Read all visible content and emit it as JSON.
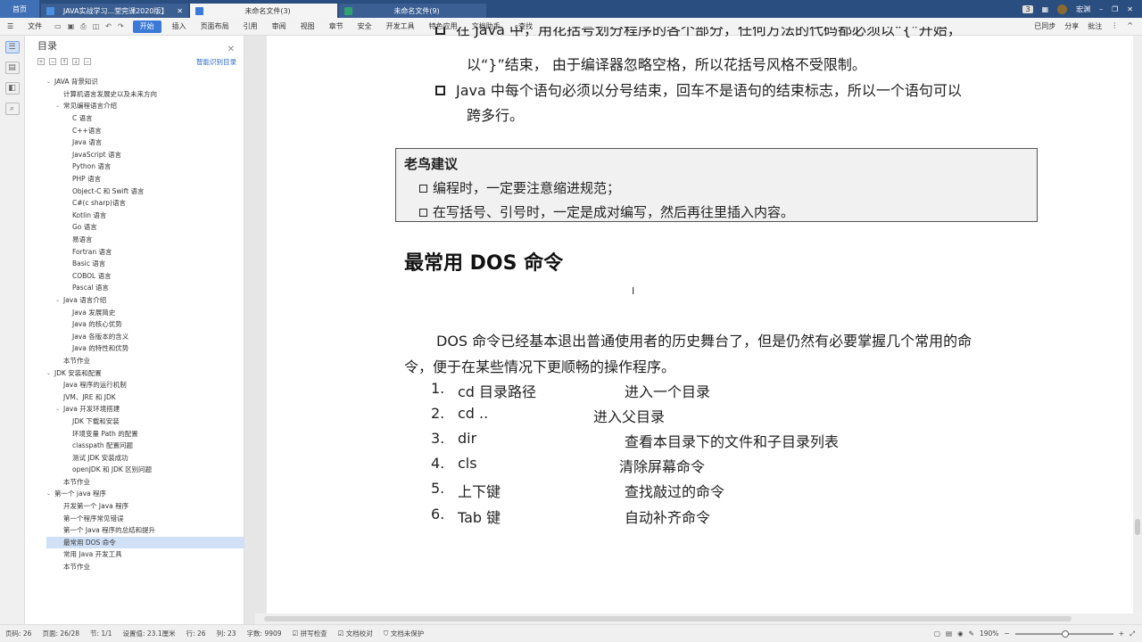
{
  "tabs": {
    "home": "首页",
    "doc1": "JAVA实战学习...堂完课2020版】",
    "doc2": "未命名文件(3)",
    "doc3": "未命名文件(9)",
    "badge": "3",
    "user": "宏渊"
  },
  "ribbon": {
    "file": "文件",
    "items": [
      "开始",
      "插入",
      "页面布局",
      "引用",
      "审阅",
      "视图",
      "章节",
      "安全",
      "开发工具",
      "特色应用",
      "文档助手"
    ],
    "search": "查找",
    "sync": "已同步",
    "share": "分享",
    "comment": "批注"
  },
  "toc": {
    "title": "目录",
    "smart": "智能识别目录",
    "items": [
      "JAVA 背景知识",
      "计算机语言发展史以及未来方向",
      "常见编程语言介绍",
      "C 语言",
      "C++语言",
      "Java 语言",
      "JavaScript 语言",
      "Python 语言",
      "PHP 语言",
      "Object-C 和 Swift 语言",
      "C#(c sharp)语言",
      "Kotlin 语言",
      "Go 语言",
      "易语言",
      "Fortran 语言",
      "Basic 语言",
      "COBOL 语言",
      "Pascal 语言",
      "Java 语言介绍",
      "Java 发展简史",
      "Java 的核心优势",
      "Java 各版本的含义",
      "Java 的特性和优势",
      "本节作业",
      "JDK 安装和配置",
      "Java 程序的运行机制",
      "JVM、JRE 和 JDK",
      "Java 开发环境搭建",
      "JDK 下载和安装",
      "环境变量 Path 的配置",
      "classpath 配置问题",
      "测试 JDK 安装成功",
      "openJDK 和 JDK 区别问题",
      "本节作业",
      "第一个 java 程序",
      "开发第一个 Java 程序",
      "第一个程序常见错误",
      "第一个 Java 程序的总结和提升",
      "最常用 DOS 命令",
      "常用 Java 开发工具",
      "本节作业"
    ]
  },
  "doc": {
    "partial_line": "在 Java 中，用花括号划分程序的各个部分，任何方法的代码都必须以“{”开始，",
    "line2": "以“}”结束， 由于编译器忽略空格，所以花括号风格不受限制。",
    "bullet2a": "Java 中每个语句必须以分号结束，回车不是语句的结束标志，所以一个语句可以",
    "bullet2b": "跨多行。",
    "box_title": "老鸟建议",
    "box_item1": "编程时，一定要注意缩进规范；",
    "box_item2": "在写括号、引号时，一定是成对编写，然后再往里插入内容。",
    "heading": "最常用 DOS 命令",
    "para1": "DOS 命令已经基本退出普通使用者的历史舞台了，但是仍然有必要掌握几个常用的命",
    "para2": "令，便于在某些情况下更顺畅的操作程序。",
    "commands": [
      {
        "num": "1.",
        "cmd": "cd   目录路径",
        "desc": "进入一个目录"
      },
      {
        "num": "2.",
        "cmd": "cd ..",
        "desc": "进入父目录"
      },
      {
        "num": "3.",
        "cmd": "dir",
        "desc": "查看本目录下的文件和子目录列表"
      },
      {
        "num": "4.",
        "cmd": "cls",
        "desc": "清除屏幕命令"
      },
      {
        "num": "5.",
        "cmd": "上下键",
        "desc": "查找敲过的命令"
      },
      {
        "num": "6.",
        "cmd": "Tab 键",
        "desc": "自动补齐命令"
      }
    ]
  },
  "status": {
    "page": "页码: 26",
    "pages": "页面: 26/28",
    "section": "节: 1/1",
    "setting": "设置值: 23.1厘米",
    "row": "行: 26",
    "col": "列: 23",
    "words": "字数: 9909",
    "spell": "拼写检查",
    "proof": "文档校对",
    "protect": "文档未保护",
    "zoom": "190%"
  }
}
